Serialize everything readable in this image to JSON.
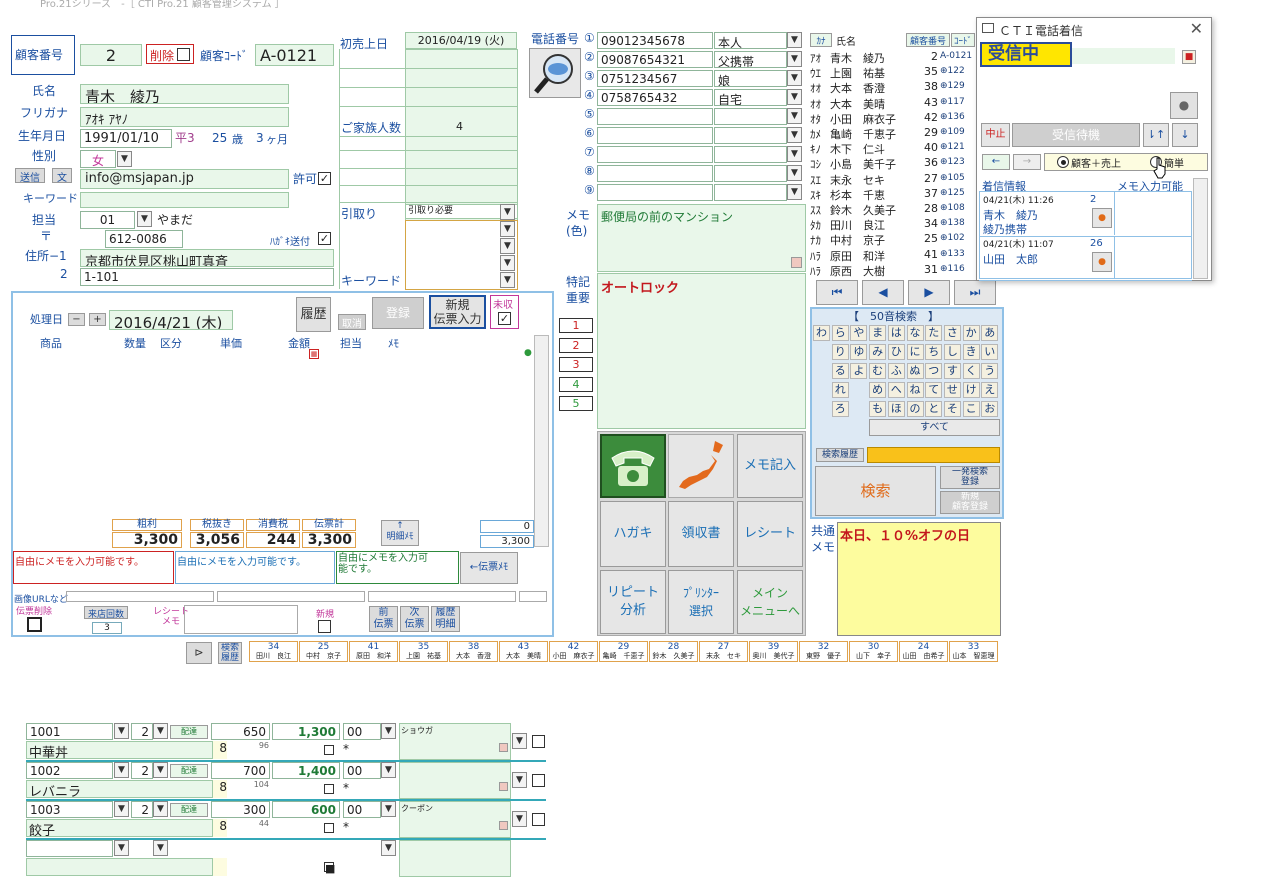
{
  "title": "Pro.21シリーズ　-［ CTI Pro.21 顧客管理システム ］",
  "customer": {
    "no_label": "顧客番号",
    "no": "2",
    "delete_label": "削除",
    "code_label": "顧客ｺｰﾄﾞ",
    "code": "A-0121",
    "name_label": "氏名",
    "name": "青木　綾乃",
    "kana_label": "フリガナ",
    "kana": "ｱｵｷ ｱﾔﾉ",
    "birth_label": "生年月日",
    "birth": "1991/01/10",
    "era": "平3",
    "age": "25",
    "age_unit": "歳",
    "months": "3",
    "months_unit": "ヶ月",
    "sex_label": "性別",
    "sex": "女",
    "send_btn": "送信",
    "text_btn": "文",
    "email": "info@msjapan.jp",
    "allow_label": "許可",
    "keyword_label": "キーワード",
    "staff_label": "担当",
    "staff_code": "01",
    "staff_name": "やまだ",
    "zip_label": "〒",
    "zip": "612-0086",
    "postcard_label": "ﾊｶﾞｷ送付",
    "addr1_label": "住所−1",
    "addr1": "京都市伏見区桃山町真斉",
    "addr2_label": "2",
    "addr2": "1-101"
  },
  "sales": {
    "first_label": "初売上日",
    "first_date": "2016/04/19 (火)",
    "family_label": "ご家族人数",
    "family": "4",
    "pickup_label": "引取り",
    "pickup_value": "引取り必要",
    "keyword_label": "キーワード"
  },
  "phones": {
    "label": "電話番号",
    "rows": [
      {
        "n": "①",
        "num": "09012345678",
        "rel": "本人"
      },
      {
        "n": "②",
        "num": "09087654321",
        "rel": "父携帯"
      },
      {
        "n": "③",
        "num": "0751234567",
        "rel": "娘"
      },
      {
        "n": "④",
        "num": "0758765432",
        "rel": "自宅"
      },
      {
        "n": "⑤",
        "num": "",
        "rel": ""
      },
      {
        "n": "⑥",
        "num": "",
        "rel": ""
      },
      {
        "n": "⑦",
        "num": "",
        "rel": ""
      },
      {
        "n": "⑧",
        "num": "",
        "rel": ""
      },
      {
        "n": "⑨",
        "num": "",
        "rel": ""
      }
    ],
    "memo_label": "メモ\n(色)",
    "memo": "郵便局の前のマンション",
    "special_label": "特記\n重要",
    "special": "オートロック"
  },
  "order": {
    "date_label": "処理日",
    "date": "2016/4/21 (木)",
    "history_btn": "履歴",
    "register_btn": "登録",
    "cancel_btn": "取消",
    "new_btn": "新規\n伝票入力",
    "unrecv_label": "未収",
    "headers": [
      "商品",
      "数量",
      "区分",
      "単価",
      "金額",
      "担当",
      "ﾒﾓ"
    ],
    "lines": [
      {
        "code": "1001",
        "qty": "2",
        "kind": "配達",
        "price": "650",
        "amount": "1,300",
        "staff": "00",
        "memo": "ショウガ",
        "name": "中華丼",
        "tax": "8",
        "sub": "96"
      },
      {
        "code": "1002",
        "qty": "2",
        "kind": "配達",
        "price": "700",
        "amount": "1,400",
        "staff": "00",
        "memo": "",
        "name": "レバニラ",
        "tax": "8",
        "sub": "104"
      },
      {
        "code": "1003",
        "qty": "2",
        "kind": "配達",
        "price": "300",
        "amount": "600",
        "staff": "00",
        "memo": "クーポン",
        "name": "餃子",
        "tax": "8",
        "sub": "44"
      }
    ],
    "tot_labels": [
      "粗利",
      "税抜き",
      "消費税",
      "伝票計"
    ],
    "totals": [
      "3,300",
      "3,056",
      "244",
      "3,300"
    ],
    "detail_btn": "↑\n明細ﾒﾓ",
    "small_total1": "0",
    "small_total2": "3,300",
    "memos": [
      "自由にメモを入力可能です。",
      "自由にメモを入力可能です。",
      "自由にメモを入力可\n能です。"
    ],
    "memo_btn": "←伝票ﾒﾓ",
    "url_label": "画像URLなど",
    "del_label": "伝票削除",
    "visits_label": "来店回数",
    "visits": "3",
    "receipt_label": "レシート\nメモ",
    "new_label": "新規",
    "prev_btn": "前\n伝票",
    "next_btn": "次\n伝票",
    "hist_btn": "履歴\n明細"
  },
  "side_numbers": [
    "1",
    "2",
    "3",
    "4",
    "5"
  ],
  "actions": {
    "memo_btn": "メモ記入",
    "postcard_btn": "ハガキ",
    "receipt_btn": "領収書",
    "receipt2_btn": "レシート",
    "repeat_btn": "リピート\n分析",
    "printer_btn": "ﾌﾟﾘﾝﾀｰ\n選択",
    "main_btn": "メイン\nメニューへ"
  },
  "customer_list": {
    "kana_hdr": "ｶﾅ",
    "name_hdr": "氏名",
    "no_hdr": "顧客番号",
    "code_hdr": "ｺｰﾄﾞ",
    "rows": [
      {
        "k": "ｱｵ",
        "name": "青木　綾乃",
        "no": "2",
        "code": "A-0121"
      },
      {
        "k": "ｳｴ",
        "name": "上園　祐基",
        "no": "35",
        "code": "⊕122"
      },
      {
        "k": "ｵｵ",
        "name": "大本　香澄",
        "no": "38",
        "code": "⊕129"
      },
      {
        "k": "ｵｵ",
        "name": "大本　美晴",
        "no": "43",
        "code": "⊕117"
      },
      {
        "k": "ｵﾀ",
        "name": "小田　麻衣子",
        "no": "42",
        "code": "⊕136"
      },
      {
        "k": "ｶﾒ",
        "name": "亀崎　千恵子",
        "no": "29",
        "code": "⊕109"
      },
      {
        "k": "ｷﾉ",
        "name": "木下　仁斗",
        "no": "40",
        "code": "⊕121"
      },
      {
        "k": "ｺｼ",
        "name": "小島　美千子",
        "no": "36",
        "code": "⊕123"
      },
      {
        "k": "ｽｴ",
        "name": "末永　セキ",
        "no": "27",
        "code": "⊕105"
      },
      {
        "k": "ｽｷ",
        "name": "杉本　千恵",
        "no": "37",
        "code": "⊕125"
      },
      {
        "k": "ｽｽ",
        "name": "鈴木　久美子",
        "no": "28",
        "code": "⊕108"
      },
      {
        "k": "ﾀｶ",
        "name": "田川　良江",
        "no": "34",
        "code": "⊕138"
      },
      {
        "k": "ﾅｶ",
        "name": "中村　京子",
        "no": "25",
        "code": "⊕102"
      },
      {
        "k": "ﾊﾗ",
        "name": "原田　和洋",
        "no": "41",
        "code": "⊕133"
      },
      {
        "k": "ﾊﾗ",
        "name": "原西　大樹",
        "no": "31",
        "code": "⊕116"
      }
    ]
  },
  "nav": [
    "⏮",
    "◀",
    "▶",
    "⏭"
  ],
  "kana_search": {
    "title": "【　50音検索　】",
    "rows": [
      [
        "わ",
        "ら",
        "や",
        "ま",
        "は",
        "な",
        "た",
        "さ",
        "か",
        "あ"
      ],
      [
        "",
        "り",
        "ゆ",
        "み",
        "ひ",
        "に",
        "ち",
        "し",
        "き",
        "い"
      ],
      [
        "",
        "る",
        "よ",
        "む",
        "ふ",
        "ぬ",
        "つ",
        "す",
        "く",
        "う"
      ],
      [
        "",
        "れ",
        "",
        "め",
        "へ",
        "ね",
        "て",
        "せ",
        "け",
        "え"
      ],
      [
        "",
        "ろ",
        "",
        "も",
        "ほ",
        "の",
        "と",
        "そ",
        "こ",
        "お"
      ]
    ],
    "all_btn": "すべて",
    "history_label": "検索履歴",
    "search_btn": "検索",
    "one_btn": "一発検索\n登録",
    "new_btn": "新規\n顧客登録"
  },
  "notice": {
    "label": "共通\nメモ",
    "text": "本日、１０%オフの日"
  },
  "history_strip": {
    "btn": "検索\n履歴",
    "items": [
      {
        "no": "34",
        "name": "田川　良江"
      },
      {
        "no": "25",
        "name": "中村　京子"
      },
      {
        "no": "41",
        "name": "原田　和洋"
      },
      {
        "no": "35",
        "name": "上園　祐基"
      },
      {
        "no": "38",
        "name": "大本　香澄"
      },
      {
        "no": "43",
        "name": "大本　美晴"
      },
      {
        "no": "42",
        "name": "小田　麻衣子"
      },
      {
        "no": "29",
        "name": "亀崎　千恵子"
      },
      {
        "no": "28",
        "name": "鈴木　久美子"
      },
      {
        "no": "27",
        "name": "末永　セキ"
      },
      {
        "no": "39",
        "name": "奥川　美代子"
      },
      {
        "no": "32",
        "name": "東野　優子"
      },
      {
        "no": "30",
        "name": "山下　幸子"
      },
      {
        "no": "24",
        "name": "山田　由希子"
      },
      {
        "no": "33",
        "name": "山本　智恵理"
      }
    ]
  },
  "cti": {
    "title": "ＣＴＩ電話着信",
    "status": "受信中",
    "stop_btn": "中止",
    "wait_btn": "受信待機",
    "up_btn": "⇂↑",
    "down_btn": "↓",
    "left_btn": "←",
    "right_btn": "→",
    "radio1": "顧客＋売上",
    "radio2": "簡単",
    "col1": "着信情報",
    "col2": "メモ入力可能",
    "calls": [
      {
        "time": "04/21(木) 11:26",
        "name": "青木　綾乃",
        "sub": "綾乃携帯",
        "no": "2"
      },
      {
        "time": "04/21(木) 11:07",
        "name": "山田　太郎",
        "sub": "",
        "no": "26"
      }
    ]
  }
}
